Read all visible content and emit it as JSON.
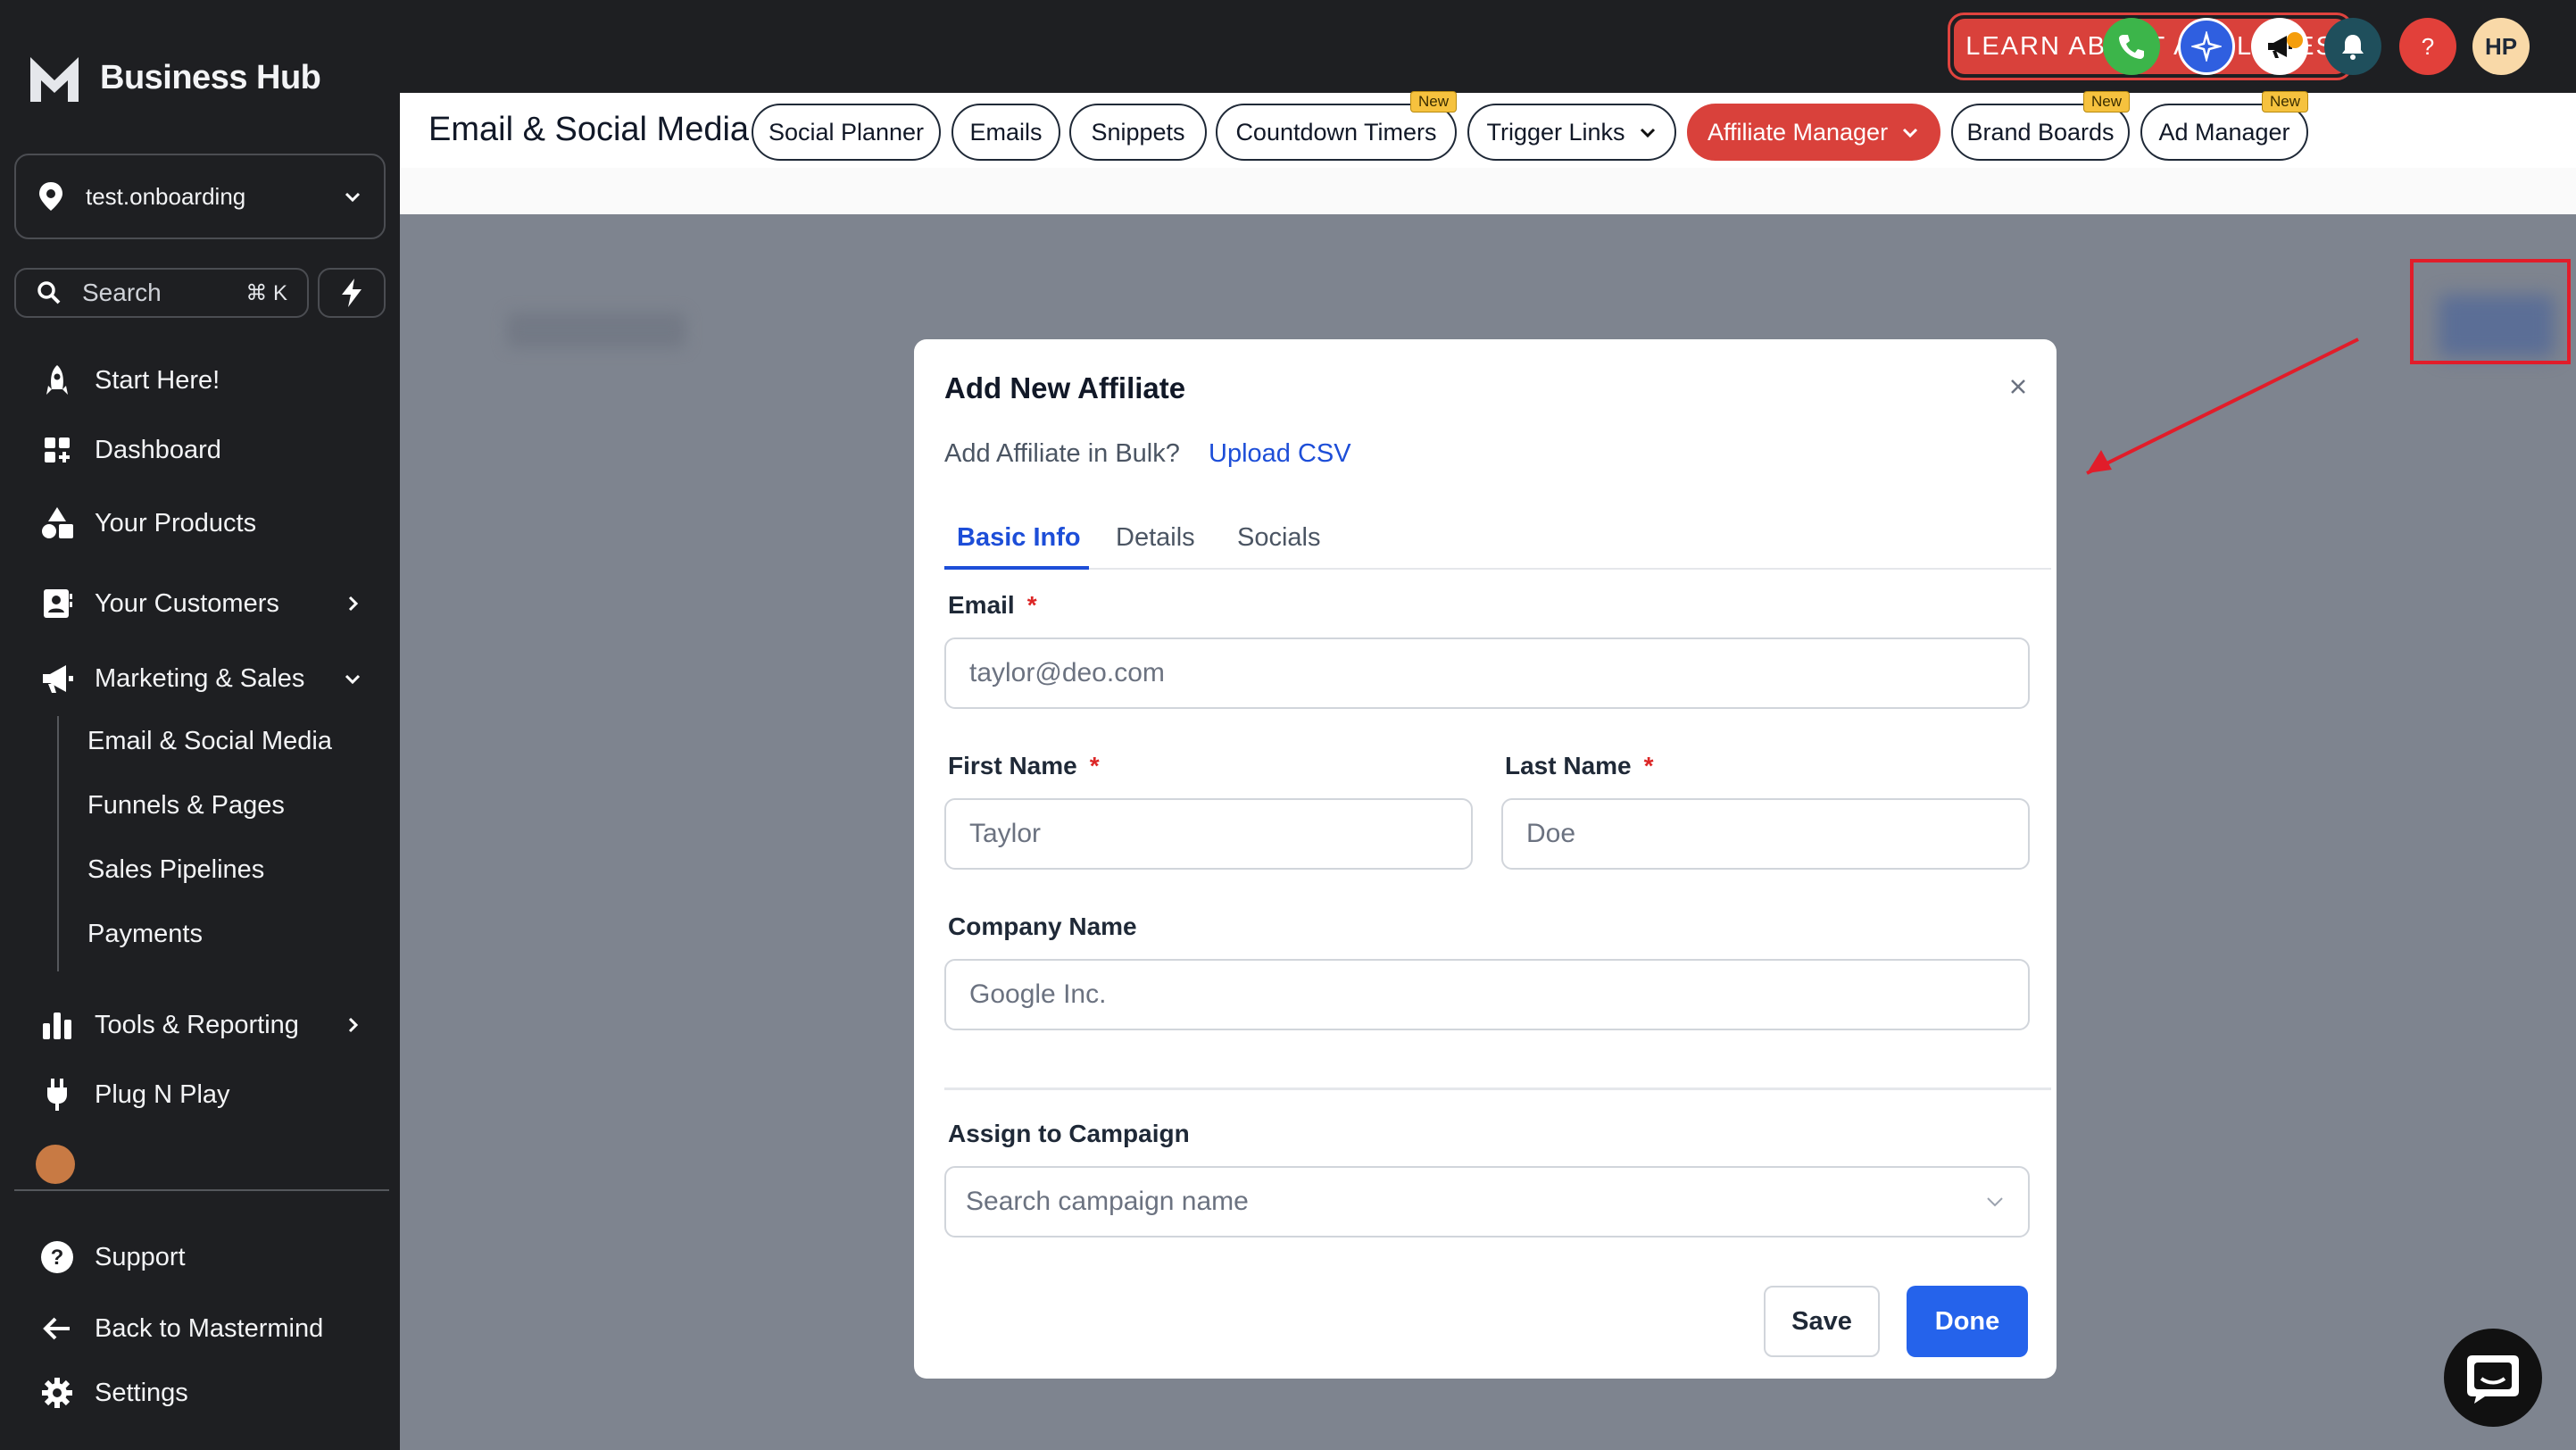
{
  "sidebar": {
    "brand": "Business Hub",
    "location": "test.onboarding",
    "search": {
      "label": "Search",
      "shortcut": "⌘ K"
    },
    "items": {
      "start": "Start Here!",
      "dashboard": "Dashboard",
      "products": "Your Products",
      "customers": "Your Customers",
      "marketing": "Marketing & Sales",
      "tools": "Tools & Reporting",
      "plug": "Plug N Play",
      "support": "Support",
      "back": "Back to Mastermind",
      "settings": "Settings"
    },
    "marketing_sub": [
      "Email & Social Media",
      "Funnels & Pages",
      "Sales Pipelines",
      "Payments"
    ]
  },
  "topbar": {
    "learn_button": "LEARN ABOUT AFFILIATES",
    "avatar_initials": "HP",
    "icons": [
      "phone-icon",
      "sparkle-icon",
      "megaphone-icon",
      "bell-icon",
      "help-icon"
    ],
    "colors": {
      "phone": "#3cb54a",
      "sparkle": "#2f5fe0",
      "megaphone": "#ffffff",
      "bell": "#1f4f5c",
      "help": "#e2403a",
      "accent": "#d9413b"
    }
  },
  "subnav": {
    "title": "Email & Social Media",
    "new_badge": "New",
    "tabs": [
      "Social Planner",
      "Emails",
      "Snippets",
      "Countdown Timers",
      "Trigger Links",
      "Affiliate Manager",
      "Brand Boards",
      "Ad Manager"
    ]
  },
  "modal": {
    "title": "Add New Affiliate",
    "bulk_text": "Add Affiliate in Bulk?",
    "upload_link": "Upload CSV",
    "tabs": [
      "Basic Info",
      "Details",
      "Socials"
    ],
    "fields": {
      "email": {
        "label": "Email",
        "placeholder": "taylor@deo.com"
      },
      "first_name": {
        "label": "First Name",
        "placeholder": "Taylor"
      },
      "last_name": {
        "label": "Last Name",
        "placeholder": "Doe"
      },
      "company": {
        "label": "Company Name",
        "placeholder": "Google Inc."
      },
      "campaign": {
        "label": "Assign to Campaign",
        "placeholder": "Search campaign name"
      }
    },
    "required_mark": "*",
    "save_label": "Save",
    "done_label": "Done"
  }
}
